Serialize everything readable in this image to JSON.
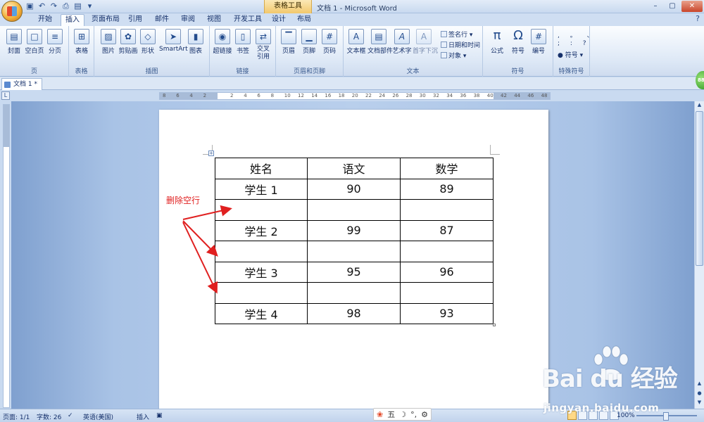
{
  "window": {
    "context_tab": "表格工具",
    "title": "文档 1 - Microsoft Word"
  },
  "ribbon_tabs": [
    "开始",
    "插入",
    "页面布局",
    "引用",
    "邮件",
    "审阅",
    "视图",
    "开发工具",
    "设计",
    "布局"
  ],
  "active_tab": "插入",
  "groups": {
    "pages": {
      "label": "页",
      "buttons": [
        "封面",
        "空白页",
        "分页"
      ]
    },
    "tables": {
      "label": "表格",
      "buttons": [
        "表格"
      ]
    },
    "illustrations": {
      "label": "插图",
      "buttons": [
        "图片",
        "剪贴画",
        "形状",
        "SmartArt",
        "图表"
      ]
    },
    "links": {
      "label": "链接",
      "buttons": [
        "超链接",
        "书签",
        "交叉引用"
      ]
    },
    "header_footer": {
      "label": "页眉和页脚",
      "buttons": [
        "页眉",
        "页脚",
        "页码"
      ]
    },
    "text": {
      "label": "文本",
      "buttons": [
        "文本框",
        "文档部件",
        "艺术字",
        "首字下沉"
      ],
      "small": [
        "签名行",
        "日期和时间",
        "对象"
      ]
    },
    "symbols": {
      "label": "符号",
      "buttons": [
        "公式",
        "符号",
        "编号"
      ]
    },
    "special": {
      "label": "特殊符号",
      "small": [
        "符号"
      ]
    }
  },
  "document_tab": "文档 1 *",
  "table": {
    "header": [
      "姓名",
      "语文",
      "数学"
    ],
    "rows": [
      [
        "学生 1",
        "90",
        "89"
      ],
      [
        "",
        "",
        ""
      ],
      [
        "学生 2",
        "99",
        "87"
      ],
      [
        "",
        "",
        ""
      ],
      [
        "学生 3",
        "95",
        "96"
      ],
      [
        "",
        "",
        ""
      ],
      [
        "学生 4",
        "98",
        "93"
      ]
    ]
  },
  "annotation": {
    "text": "删除空行",
    "color": "#e02020"
  },
  "status": {
    "page": "页面: 1/1",
    "words": "字数: 26",
    "language": "英语(美国)",
    "mode": "插入",
    "zoom": "100%"
  },
  "ime": {
    "mode": "五"
  },
  "watermark": {
    "brand": "Bai  du 经验",
    "url": "jingyan.baidu.com"
  }
}
